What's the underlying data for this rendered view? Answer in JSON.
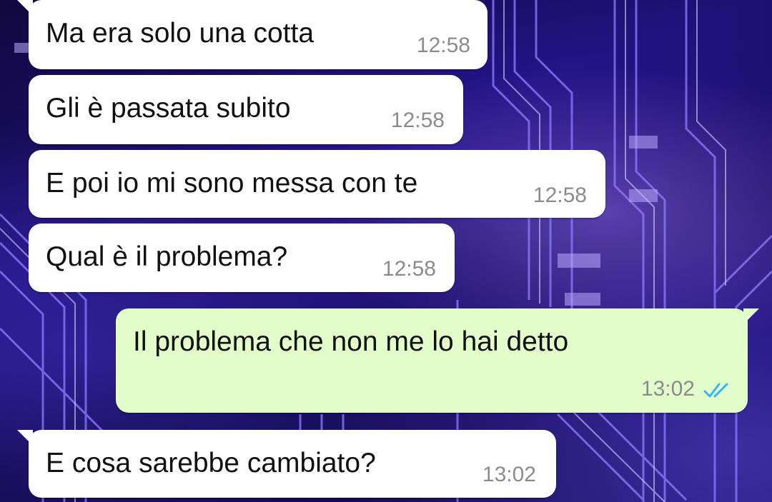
{
  "messages": [
    {
      "direction": "incoming",
      "text": "Ma era solo una cotta",
      "time": "12:58"
    },
    {
      "direction": "incoming",
      "text": "Gli è passata subito",
      "time": "12:58"
    },
    {
      "direction": "incoming",
      "text": "E poi io mi sono messa con te",
      "time": "12:58"
    },
    {
      "direction": "incoming",
      "text": "Qual è il problema?",
      "time": "12:58"
    },
    {
      "direction": "outgoing",
      "text": "Il problema che non me lo hai detto",
      "time": "13:02",
      "status_icon": "double-check-read-icon"
    },
    {
      "direction": "incoming",
      "text": "E cosa sarebbe cambiato?",
      "time": "13:02"
    }
  ],
  "colors": {
    "incoming_bubble": "#ffffff",
    "outgoing_bubble": "#e2fdc9",
    "time_text": "#8b8b8b",
    "read_ticks": "#34b7f1"
  }
}
